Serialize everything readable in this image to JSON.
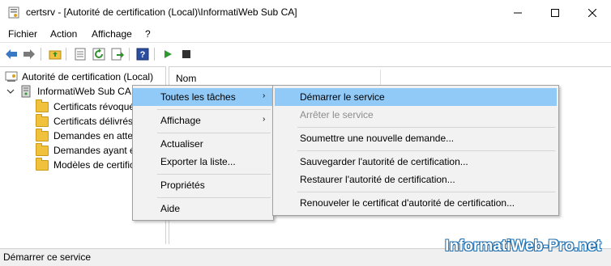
{
  "window": {
    "title": "certsrv - [Autorité de certification (Local)\\InformatiWeb Sub CA]",
    "minimize_icon": "minimize-icon",
    "maximize_icon": "maximize-icon",
    "close_icon": "close-icon"
  },
  "menubar": {
    "items": [
      "Fichier",
      "Action",
      "Affichage",
      "?"
    ]
  },
  "toolbar": {
    "icons": [
      "back-arrow-icon",
      "forward-arrow-icon",
      "up-folder-icon",
      "properties-icon",
      "refresh-icon",
      "export-list-icon",
      "help-icon",
      "play-icon",
      "stop-icon"
    ]
  },
  "tree": {
    "root": "Autorité de certification (Local)",
    "ca": "InformatiWeb Sub CA",
    "children": [
      "Certificats révoqués",
      "Certificats délivrés",
      "Demandes en attente",
      "Demandes ayant échoué",
      "Modèles de certificats"
    ]
  },
  "detail": {
    "column_header": "Nom"
  },
  "context_menu": {
    "items": [
      "Toutes les tâches",
      "Affichage",
      "Actualiser",
      "Exporter la liste...",
      "Propriétés",
      "Aide"
    ]
  },
  "submenu": {
    "items": [
      "Démarrer le service",
      "Arrêter le service",
      "Soumettre une nouvelle demande...",
      "Sauvegarder l'autorité de certification...",
      "Restaurer l'autorité de certification...",
      "Renouveler le certificat d'autorité de certification..."
    ]
  },
  "statusbar": {
    "text": "Démarrer ce service"
  },
  "watermark": "InformatiWeb-Pro.net",
  "colors": {
    "highlight": "#91c9f7",
    "menu_bg": "#f2f2f2",
    "disabled_text": "#8c8c8c"
  }
}
